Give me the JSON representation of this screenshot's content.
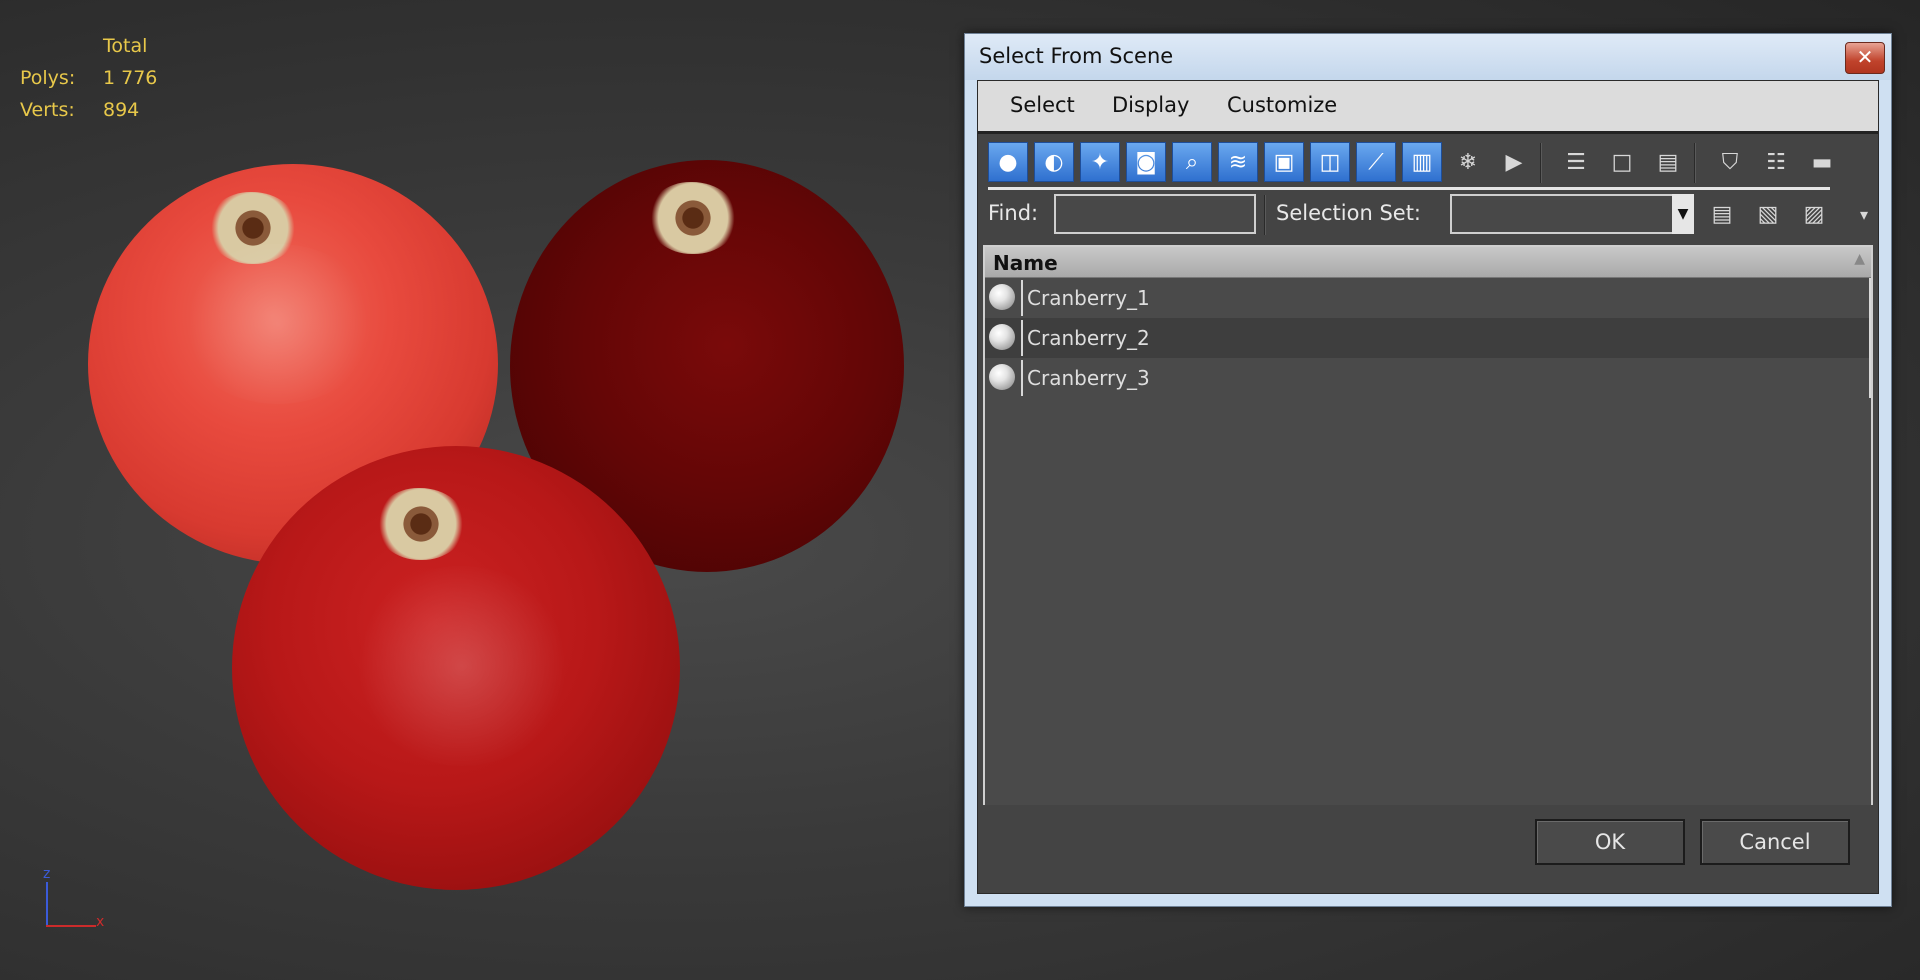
{
  "viewport": {
    "stats": {
      "header": "Total",
      "polys_label": "Polys:",
      "polys_value": "1 776",
      "verts_label": "Verts:",
      "verts_value": "894"
    },
    "axis": {
      "z_label": "z",
      "x_label": "x"
    }
  },
  "dialog": {
    "title": "Select From Scene",
    "close_glyph": "✕",
    "menu": [
      "Select",
      "Display",
      "Customize"
    ],
    "toolbar_icons": [
      {
        "name": "geometry-filter-icon",
        "glyph": "●",
        "active": true
      },
      {
        "name": "shapes-filter-icon",
        "glyph": "◐",
        "active": true
      },
      {
        "name": "lights-filter-icon",
        "glyph": "✦",
        "active": true
      },
      {
        "name": "cameras-filter-icon",
        "glyph": "◙",
        "active": true
      },
      {
        "name": "helpers-filter-icon",
        "glyph": "⌕",
        "active": true
      },
      {
        "name": "space-warps-filter-icon",
        "glyph": "≋",
        "active": true
      },
      {
        "name": "groups-filter-icon",
        "glyph": "▣",
        "active": true
      },
      {
        "name": "xrefs-filter-icon",
        "glyph": "◫",
        "active": true
      },
      {
        "name": "bones-filter-icon",
        "glyph": "⟋",
        "active": true
      },
      {
        "name": "containers-filter-icon",
        "glyph": "▥",
        "active": true
      },
      {
        "name": "frozen-filter-icon",
        "glyph": "❄",
        "active": false
      },
      {
        "name": "hidden-filter-icon",
        "glyph": "▶",
        "active": false
      },
      {
        "name": "select-all-icon",
        "glyph": "☰",
        "active": false
      },
      {
        "name": "select-none-icon",
        "glyph": "□",
        "active": false
      },
      {
        "name": "select-invert-icon",
        "glyph": "▤",
        "active": false
      },
      {
        "name": "filter-icon",
        "glyph": "⛉",
        "active": false
      },
      {
        "name": "filter-list-icon",
        "glyph": "☷",
        "active": false
      },
      {
        "name": "toggle-display-icon",
        "glyph": "▬",
        "active": false
      }
    ],
    "find_label": "Find:",
    "find_value": "",
    "selection_set_label": "Selection Set:",
    "selection_set_value": "",
    "selection_set_arrow": "▼",
    "set_icons": [
      {
        "name": "create-set-icon",
        "glyph": "▤"
      },
      {
        "name": "add-to-set-icon",
        "glyph": "▧"
      },
      {
        "name": "remove-from-set-icon",
        "glyph": "▨"
      },
      {
        "name": "options-dropdown-icon",
        "glyph": "▾"
      }
    ],
    "list": {
      "column_header": "Name",
      "sort_glyph": "▲",
      "items": [
        "Cranberry_1",
        "Cranberry_2",
        "Cranberry_3"
      ]
    },
    "ok_label": "OK",
    "cancel_label": "Cancel"
  }
}
